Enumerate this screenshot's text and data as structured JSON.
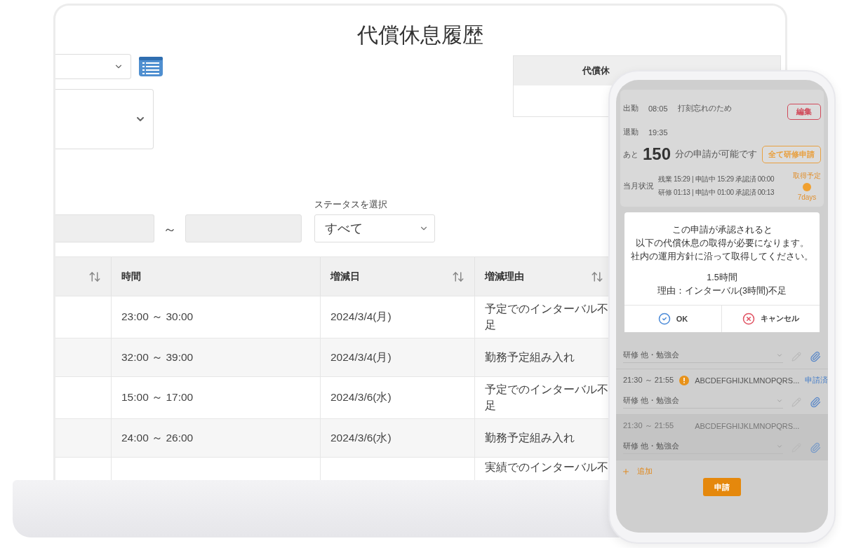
{
  "laptop": {
    "title": "代償休息履歴",
    "panel_header": "代償休",
    "range_separator": "～",
    "status_filter": {
      "label": "ステータスを選択",
      "value": "すべて"
    },
    "table": {
      "columns": [
        {
          "sortable": true
        },
        {
          "label": "時間",
          "sortable": false
        },
        {
          "label": "増減日",
          "sortable": true
        },
        {
          "label": "増減理由",
          "sortable": true
        }
      ],
      "rows": [
        {
          "time": "23:00 ～ 30:00",
          "date": "2024/3/4(月)",
          "reason": "予定でのインターバル不足"
        },
        {
          "time": "32:00 ～ 39:00",
          "date": "2024/3/4(月)",
          "reason": "勤務予定組み入れ"
        },
        {
          "time": "15:00 ～ 17:00",
          "date": "2024/3/6(水)",
          "reason": "予定でのインターバル不足"
        },
        {
          "time": "24:00 ～ 26:00",
          "date": "2024/3/6(水)",
          "reason": "勤務予定組み入れ"
        },
        {
          "reason": "実績でのインターバル不"
        }
      ]
    }
  },
  "phone": {
    "clock_in": {
      "label": "出勤",
      "time": "08:05",
      "note": "打刻忘れのため"
    },
    "edit_button": "編集",
    "clock_out": {
      "label": "退勤",
      "time": "19:35"
    },
    "remaining": {
      "prefix": "あと",
      "value": "150",
      "suffix": "分の申請が可能です"
    },
    "apply_all_button": "全て研修申請",
    "monthly": {
      "label": "当月状況",
      "lines": [
        "残業 15:29 | 申請中 15:29 承認済 00:00",
        "研修 01:13 | 申請中 01:00 承認済 00:13"
      ],
      "plan_label": "取得予定",
      "plan_days": "7days"
    },
    "dialog": {
      "message": [
        "この申請が承認されると",
        "以下の代償休息の取得が必要になります。",
        "社内の運用方針に沿って取得してください。"
      ],
      "amount": "1.5時間",
      "reason": "理由：インターバル(3時間)不足",
      "ok": "OK",
      "cancel": "キャンセル"
    },
    "entries": [
      {
        "category": "研修 他・勉強会",
        "disabled": false
      },
      {
        "time": "21:30 ～ 21:55",
        "warning": true,
        "memo": "ABCDEFGHIJKLMNOPQRS...",
        "status": "申請済",
        "category": "研修 他・勉強会",
        "disabled": false
      },
      {
        "time": "21:30 ～ 21:55",
        "warning": false,
        "memo": "ABCDEFGHIJKLMNOPQRS...",
        "category": "研修 他・勉強会",
        "disabled": true
      }
    ],
    "add_link": "追加",
    "submit_button": "申請"
  }
}
